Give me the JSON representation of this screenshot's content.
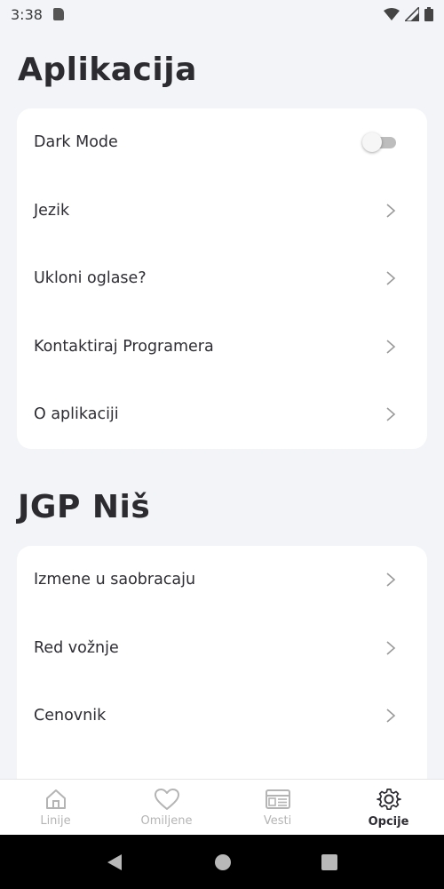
{
  "status": {
    "time": "3:38"
  },
  "sections": [
    {
      "title": "Aplikacija",
      "items": [
        {
          "label": "Dark Mode",
          "type": "toggle",
          "on": false
        },
        {
          "label": "Jezik",
          "type": "link"
        },
        {
          "label": "Ukloni oglase?",
          "type": "link"
        },
        {
          "label": "Kontaktiraj Programera",
          "type": "link"
        },
        {
          "label": "O aplikaciji",
          "type": "link"
        }
      ]
    },
    {
      "title": "JGP Niš",
      "items": [
        {
          "label": "Izmene u saobracaju",
          "type": "link"
        },
        {
          "label": "Red vožnje",
          "type": "link"
        },
        {
          "label": "Cenovnik",
          "type": "link"
        }
      ]
    }
  ],
  "bottom_nav": [
    {
      "label": "Linije",
      "icon": "home-icon",
      "active": false
    },
    {
      "label": "Omiljene",
      "icon": "heart-icon",
      "active": false
    },
    {
      "label": "Vesti",
      "icon": "news-icon",
      "active": false
    },
    {
      "label": "Opcije",
      "icon": "gear-icon",
      "active": true
    }
  ],
  "colors": {
    "background": "#f2f4f7",
    "card": "#ffffff",
    "text": "#2d2d33",
    "nav_inactive": "#b4b4b4"
  }
}
